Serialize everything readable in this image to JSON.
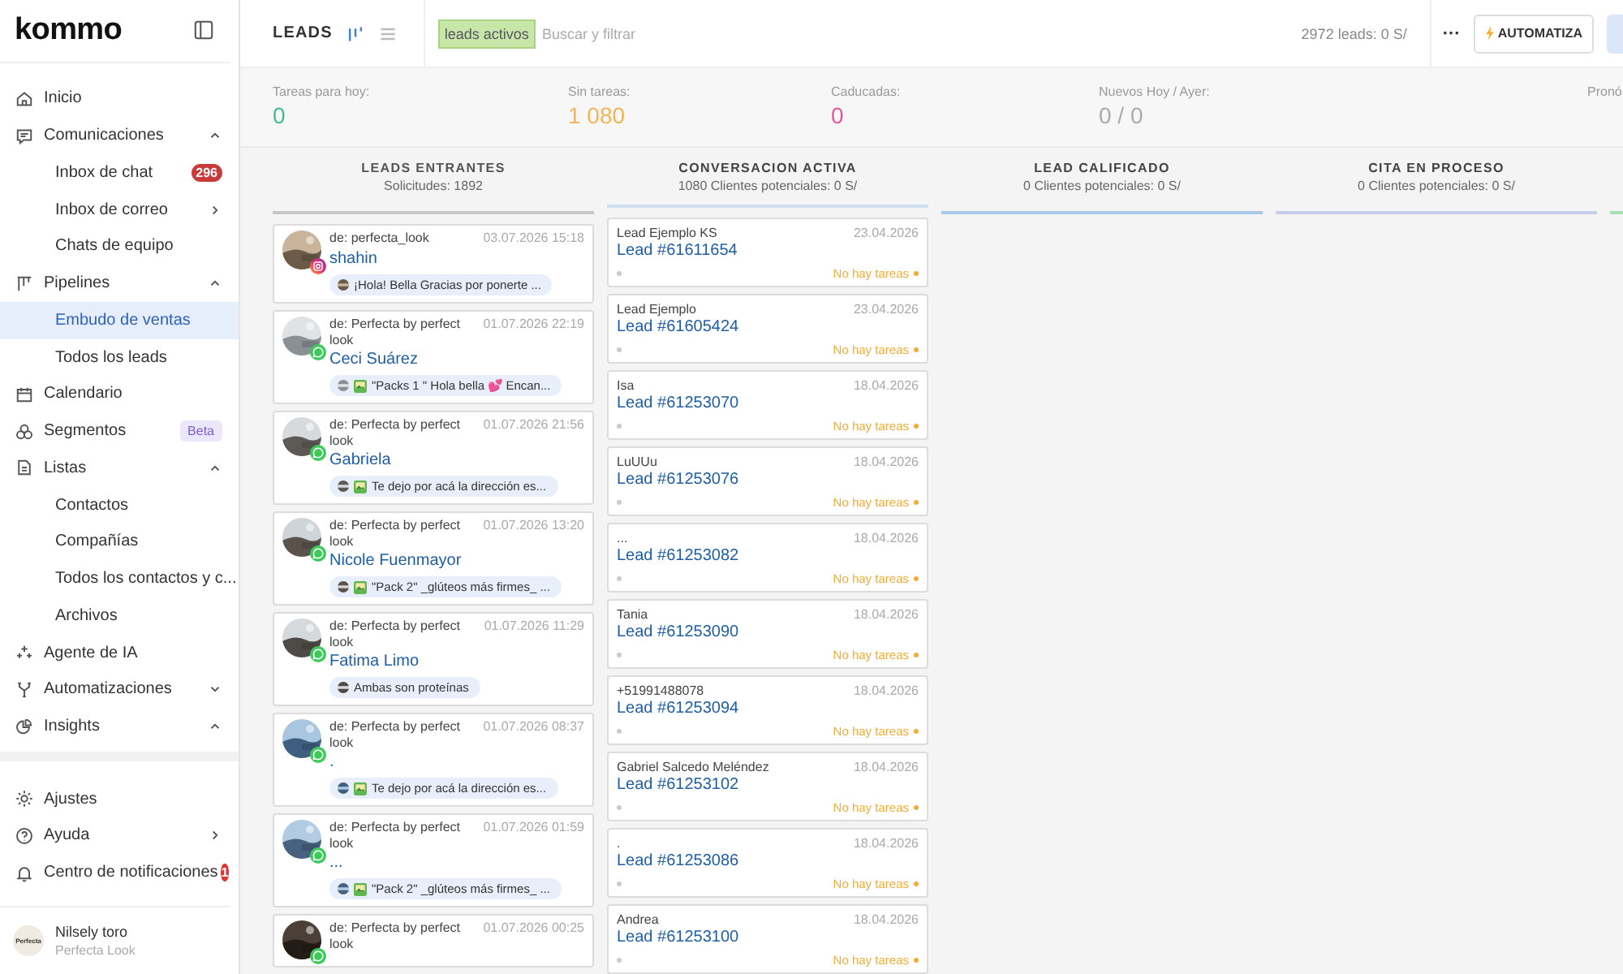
{
  "logo": "kommo",
  "nav": [
    {
      "label": "Inicio",
      "selected": false
    },
    {
      "label": "Comunicaciones",
      "selected": false,
      "expanded": true,
      "children": [
        {
          "label": "Inbox de chat",
          "selected": false,
          "badge": "296"
        },
        {
          "label": "Inbox de correo",
          "selected": false,
          "submenu": true
        },
        {
          "label": "Chats de equipo",
          "selected": false
        }
      ]
    },
    {
      "label": "Pipelines",
      "selected": false,
      "expanded": true,
      "children": [
        {
          "label": "Embudo de ventas",
          "selected": true
        },
        {
          "label": "Todos los leads",
          "selected": false
        }
      ]
    },
    {
      "label": "Calendario",
      "selected": false
    },
    {
      "label": "Segmentos",
      "selected": false,
      "tag": "Beta"
    },
    {
      "label": "Listas",
      "selected": false,
      "expanded": true,
      "children": [
        {
          "label": "Contactos",
          "selected": false
        },
        {
          "label": "Compañías",
          "selected": false
        },
        {
          "label": "Todos los contactos y c...",
          "selected": false
        },
        {
          "label": "Archivos",
          "selected": false
        }
      ]
    },
    {
      "label": "Agente de IA",
      "selected": false
    },
    {
      "label": "Automatizaciones",
      "selected": false,
      "expanded": false
    },
    {
      "label": "Insights",
      "selected": false,
      "expanded": true
    }
  ],
  "bottom_nav": [
    {
      "label": "Ajustes",
      "selected": false
    },
    {
      "label": "Ayuda",
      "selected": false,
      "submenu": true
    },
    {
      "label": "Centro de notificaciones",
      "selected": false,
      "badge": "1"
    }
  ],
  "user": {
    "avatar_text": "Perfecta",
    "name": "Nilsely toro",
    "company": "Perfecta Look"
  },
  "header": {
    "title": "LEADS",
    "filter_chip": "leads activos",
    "search": {
      "placeholder": "Buscar y filtrar"
    },
    "summary": "2972 leads: 0 S/",
    "more": "···",
    "automate": "AUTOMATIZA"
  },
  "stats": [
    {
      "label": "Tareas para hoy:",
      "value": "0",
      "color": "#3fbf8c"
    },
    {
      "label": "Sin tareas:",
      "value": "1 080",
      "color": "#f2b455"
    },
    {
      "label": "Caducadas:",
      "value": "0",
      "color": "#e8559c"
    },
    {
      "label": "Nuevos Hoy / Ayer:",
      "value": "0 / 0",
      "color": "#aaaaaa"
    },
    {
      "label": "Pronó"
    }
  ],
  "columns": [
    {
      "kind": "incoming",
      "title": "LEADS ENTRANTES",
      "subtitle": "Solicitudes: 1892",
      "color": "#c8c8c8",
      "cards": [
        {
          "sender": "de: perfecta_look",
          "date": "03.07.2026 15:18",
          "name": "shahin",
          "kind": "instagram",
          "media": false,
          "message": "¡Hola! Bella Gracias por ponerte ..."
        },
        {
          "sender": "de: Perfecta by perfect look",
          "date": "01.07.2026 22:19",
          "name": "Ceci Suárez",
          "kind": "whatsapp",
          "media": true,
          "message": "\"Packs 1 \" Hola bella 💕 Encan..."
        },
        {
          "sender": "de: Perfecta by perfect look",
          "date": "01.07.2026 21:56",
          "name": "Gabriela",
          "kind": "whatsapp",
          "media": true,
          "message": "Te dejo por acá la dirección es..."
        },
        {
          "sender": "de: Perfecta by perfect look",
          "date": "01.07.2026 13:20",
          "name": "Nicole Fuenmayor",
          "kind": "whatsapp",
          "media": true,
          "message": "\"Pack 2\" _glúteos más firmes_ ..."
        },
        {
          "sender": "de: Perfecta by perfect look",
          "date": "01.07.2026 11:29",
          "name": "Fatima Limo",
          "kind": "whatsapp",
          "media": false,
          "message": "Ambas son proteínas"
        },
        {
          "sender": "de: Perfecta by perfect look",
          "date": "01.07.2026 08:37",
          "name": ".",
          "kind": "whatsapp",
          "media": true,
          "message": "Te dejo por acá la dirección es..."
        },
        {
          "sender": "de: Perfecta by perfect look",
          "date": "01.07.2026 01:59",
          "name": "...",
          "kind": "whatsapp",
          "media": true,
          "message": "\"Pack 2\" _glúteos más firmes_ ..."
        },
        {
          "sender": "de: Perfecta by perfect look",
          "date": "01.07.2026 00:25",
          "kind": "whatsapp"
        }
      ]
    },
    {
      "kind": "leads",
      "title": "CONVERSACION ACTIVA",
      "subtitle": "1080 Clientes potenciales: 0 S/",
      "color": "#cfe0f4",
      "cards": [
        {
          "contact": "Lead Ejemplo KS",
          "date": "23.04.2026",
          "lead": "Lead #61611654",
          "tasks": "No hay tareas"
        },
        {
          "contact": "Lead Ejemplo",
          "date": "23.04.2026",
          "lead": "Lead #61605424",
          "tasks": "No hay tareas"
        },
        {
          "contact": "Isa",
          "date": "18.04.2026",
          "lead": "Lead #61253070",
          "tasks": "No hay tareas"
        },
        {
          "contact": "LuUUu",
          "date": "18.04.2026",
          "lead": "Lead #61253076",
          "tasks": "No hay tareas"
        },
        {
          "contact": "...",
          "date": "18.04.2026",
          "lead": "Lead #61253082",
          "tasks": "No hay tareas"
        },
        {
          "contact": "Tania",
          "date": "18.04.2026",
          "lead": "Lead #61253090",
          "tasks": "No hay tareas"
        },
        {
          "contact": "+51991488078",
          "date": "18.04.2026",
          "lead": "Lead #61253094",
          "tasks": "No hay tareas"
        },
        {
          "contact": "Gabriel Salcedo Meléndez",
          "date": "18.04.2026",
          "lead": "Lead #61253102",
          "tasks": "No hay tareas"
        },
        {
          "contact": ".",
          "date": "18.04.2026",
          "lead": "Lead #61253086",
          "tasks": "No hay tareas"
        },
        {
          "contact": "Andrea",
          "date": "18.04.2026",
          "lead": "Lead #61253100",
          "tasks": "No hay tareas"
        }
      ]
    },
    {
      "kind": "leads",
      "title": "LEAD CALIFICADO",
      "subtitle": "0 Clientes potenciales: 0 S/",
      "color": "#a9c9e8"
    },
    {
      "kind": "leads",
      "title": "CITA EN PROCESO",
      "subtitle": "0 Clientes potenciales: 0 S/",
      "color": "#c9cce9"
    },
    {
      "kind": "leads",
      "color": "#a8e2b4"
    }
  ]
}
